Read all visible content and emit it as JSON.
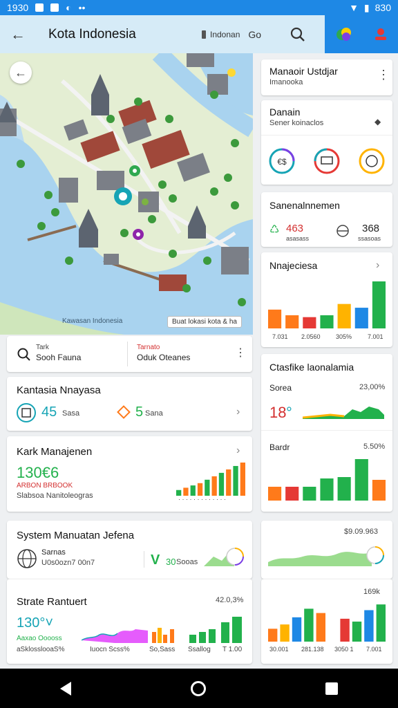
{
  "status": {
    "time": "1930",
    "battery": "830"
  },
  "header": {
    "title": "Kota Indonesia",
    "location": "Indonan",
    "go": "Go"
  },
  "map": {
    "caption": "Kawasan Indonesia",
    "chip": "Buat lokasi kota & ha"
  },
  "search_card": {
    "small": "Tark",
    "label": "Sooh Fauna",
    "right_top": "Tarnato",
    "right_bottom": "Oduk Oteanes"
  },
  "kartu": {
    "title": "Kantasia Nnayasa",
    "item1_value": "45",
    "item1_label": "Sasa",
    "item2_value": "5",
    "item2_label": "Sana"
  },
  "kark": {
    "title": "Kark Manajenen",
    "value": "130€6",
    "note": "ARBON BRBOOK",
    "sub": "Slabsoa Nanitoleogras"
  },
  "system": {
    "title": "System Manuatan Jefena",
    "row_label": "Sarnas",
    "row_sub": "U0s0ozn7 00n7",
    "v": "V",
    "v_value": "30",
    "v_unit": "Sooas"
  },
  "strata": {
    "title": "Strate Rantuert",
    "value": "130°˅",
    "right_value": "42.0,3%",
    "note": "Aaxao Ooooss",
    "sub": "aSklosslooaS%",
    "l1": "Iuocn Scss%",
    "l2": "So,Sass",
    "l3": "Ssallog",
    "l4": "T 1.00"
  },
  "right1": {
    "title": "Manaoir Ustdjar",
    "sub": "Imanooka"
  },
  "right2": {
    "title": "Danain",
    "sub": "Sener koinaclos"
  },
  "right3": {
    "title": "Sanenalnnemen",
    "v1": "463",
    "v1_label": "asasass",
    "v2": "368",
    "v2_label": "ssasoas"
  },
  "right4": {
    "title": "Nnajeciesa",
    "x1": "7.031",
    "x2": "2.0560",
    "x3": "305%",
    "x4": "7.001"
  },
  "right5": {
    "title": "Ctasfike laonalamia",
    "sub1": "Sorea",
    "sub1_right": "23,00%",
    "val": "18",
    "sub2": "Bardr",
    "sub2_right": "5.50%"
  },
  "right6": {
    "value": "$9.09.963"
  },
  "right7": {
    "value": "169k",
    "x1": "30.001",
    "x2": "281.138",
    "x3": "3050 1",
    "x4": "7.001"
  },
  "colors": {
    "primary": "#1e88e5",
    "green": "#22b14c",
    "orange": "#ff7a1a",
    "red": "#e53935",
    "teal": "#16a4b5"
  },
  "chart_data": [
    {
      "type": "bar",
      "values": [
        10,
        14,
        18,
        22,
        28,
        34,
        40,
        46,
        52,
        58
      ]
    },
    {
      "type": "bar",
      "values": [
        20,
        14,
        12,
        14,
        26,
        22,
        50
      ]
    },
    {
      "type": "bar",
      "values": [
        20,
        20,
        20,
        32,
        34,
        60,
        30
      ]
    },
    {
      "type": "bar",
      "values": [
        18,
        24,
        34,
        46,
        40,
        58,
        32,
        28,
        44,
        52
      ]
    }
  ]
}
